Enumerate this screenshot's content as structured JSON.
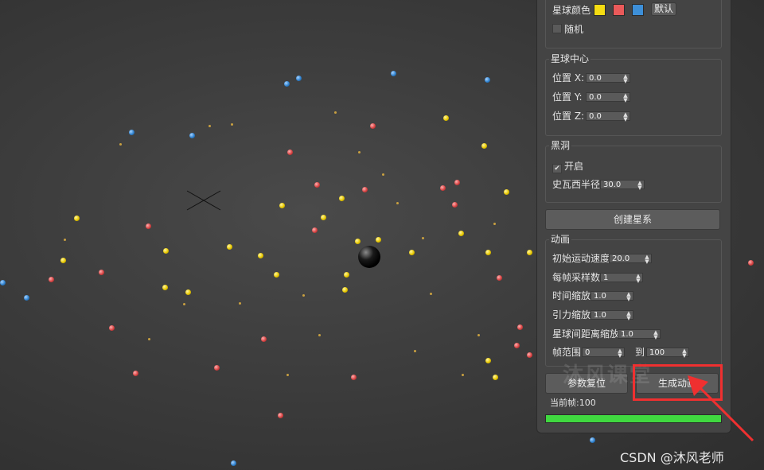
{
  "panel": {
    "star_color": {
      "label": "星球颜色",
      "colors": [
        "#f5dc12",
        "#ea5a5a",
        "#3d8fd8"
      ],
      "default_label": "默认"
    },
    "random": {
      "label": "随机",
      "checked": false
    },
    "star_center": {
      "title": "星球中心",
      "pos_x_label": "位置 X:",
      "pos_x_value": "0.0",
      "pos_y_label": "位置 Y:",
      "pos_y_value": "0.0",
      "pos_z_label": "位置 Z:",
      "pos_z_value": "0.0"
    },
    "black_hole": {
      "title": "黑洞",
      "enable_label": "开启",
      "enable_checked": true,
      "radius_label": "史瓦西半径",
      "radius_value": "30.0"
    },
    "create_galaxy_label": "创建星系",
    "animation": {
      "title": "动画",
      "init_speed_label": "初始运动速度",
      "init_speed_value": "20.0",
      "samples_label": "每帧采样数",
      "samples_value": "1",
      "time_scale_label": "时间缩放",
      "time_scale_value": "1.0",
      "gravity_scale_label": "引力缩放",
      "gravity_scale_value": "1.0",
      "distance_scale_label": "星球间距离缩放",
      "distance_scale_value": "1.0",
      "frame_range_label": "帧范围",
      "frame_from": "0",
      "to_label": "到",
      "frame_to": "100"
    },
    "reset_label": "参数复位",
    "generate_label": "生成动画",
    "current_frame_label": "当前帧:100",
    "progress": 1.0
  },
  "watermark": "沐风课堂",
  "credit": "CSDN @沐风老师"
}
